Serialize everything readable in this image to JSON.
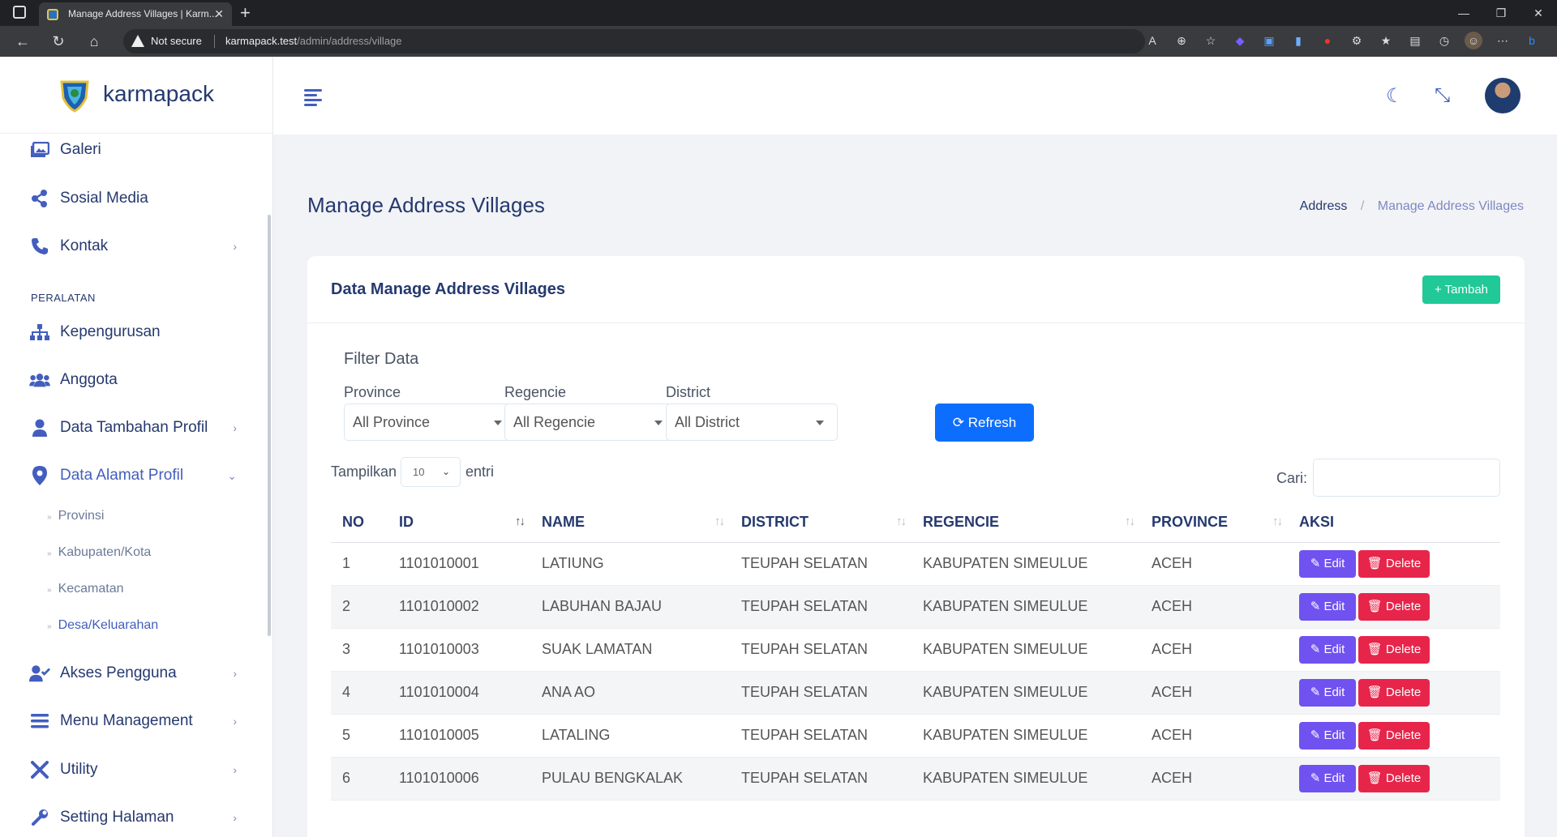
{
  "browser": {
    "tab_title": "Manage Address Villages | Karm...",
    "new_tab": "+",
    "win_minimize": "—",
    "win_restore": "❐",
    "win_close": "✕",
    "security_label": "Not secure",
    "url_host": "karmapack.test",
    "url_path": "/admin/address/village"
  },
  "brand": {
    "name": "karmapack"
  },
  "sidebar": {
    "items": [
      {
        "label": "Galeri",
        "icon": "images-icon"
      },
      {
        "label": "Sosial Media",
        "icon": "share-icon"
      },
      {
        "label": "Kontak",
        "icon": "phone-icon",
        "chevron": "›"
      }
    ],
    "section_title": "PERALATAN",
    "tools": [
      {
        "label": "Kepengurusan",
        "icon": "sitemap-icon"
      },
      {
        "label": "Anggota",
        "icon": "users-icon"
      },
      {
        "label": "Data Tambahan Profil",
        "icon": "user-icon",
        "chevron": "›"
      },
      {
        "label": "Data Alamat Profil",
        "icon": "map-marker-icon",
        "chevron": "⌄"
      },
      {
        "label": "Akses Pengguna",
        "icon": "user-check-icon",
        "chevron": "›"
      },
      {
        "label": "Menu Management",
        "icon": "bars-icon",
        "chevron": "›"
      },
      {
        "label": "Utility",
        "icon": "tools-icon",
        "chevron": "›"
      },
      {
        "label": "Setting Halaman",
        "icon": "wrench-icon",
        "chevron": "›"
      }
    ],
    "submenu": [
      "Provinsi",
      "Kabupaten/Kota",
      "Kecamatan",
      "Desa/Keluarahan"
    ]
  },
  "page": {
    "title": "Manage Address Villages",
    "breadcrumb": {
      "parent": "Address",
      "separator": "/",
      "current": "Manage Address Villages"
    }
  },
  "card": {
    "title": "Data Manage Address Villages",
    "add_button": "+ Tambah",
    "filter_title": "Filter Data",
    "filters": [
      {
        "label": "Province",
        "value": "All Province"
      },
      {
        "label": "Regencie",
        "value": "All Regencie"
      },
      {
        "label": "District",
        "value": "All District"
      }
    ],
    "refresh_button": "⟳ Refresh",
    "length_prefix": "Tampilkan",
    "length_value": "10",
    "length_suffix": "entri",
    "search_label": "Cari:",
    "search_value": ""
  },
  "table": {
    "columns": [
      "NO",
      "ID",
      "NAME",
      "DISTRICT",
      "REGENCIE",
      "PROVINCE",
      "AKSI"
    ],
    "rows": [
      [
        "1",
        "1101010001",
        "LATIUNG",
        "TEUPAH SELATAN",
        "KABUPATEN SIMEULUE",
        "ACEH"
      ],
      [
        "2",
        "1101010002",
        "LABUHAN BAJAU",
        "TEUPAH SELATAN",
        "KABUPATEN SIMEULUE",
        "ACEH"
      ],
      [
        "3",
        "1101010003",
        "SUAK LAMATAN",
        "TEUPAH SELATAN",
        "KABUPATEN SIMEULUE",
        "ACEH"
      ],
      [
        "4",
        "1101010004",
        "ANA AO",
        "TEUPAH SELATAN",
        "KABUPATEN SIMEULUE",
        "ACEH"
      ],
      [
        "5",
        "1101010005",
        "LATALING",
        "TEUPAH SELATAN",
        "KABUPATEN SIMEULUE",
        "ACEH"
      ],
      [
        "6",
        "1101010006",
        "PULAU BENGKALAK",
        "TEUPAH SELATAN",
        "KABUPATEN SIMEULUE",
        "ACEH"
      ]
    ],
    "edit_label": "✎ Edit",
    "delete_label": "🗑 Delete"
  },
  "colors": {
    "primary": "#435ebe",
    "add": "#20c997",
    "refresh": "#0d6efd",
    "edit": "#7052f0",
    "delete": "#e7254a"
  }
}
